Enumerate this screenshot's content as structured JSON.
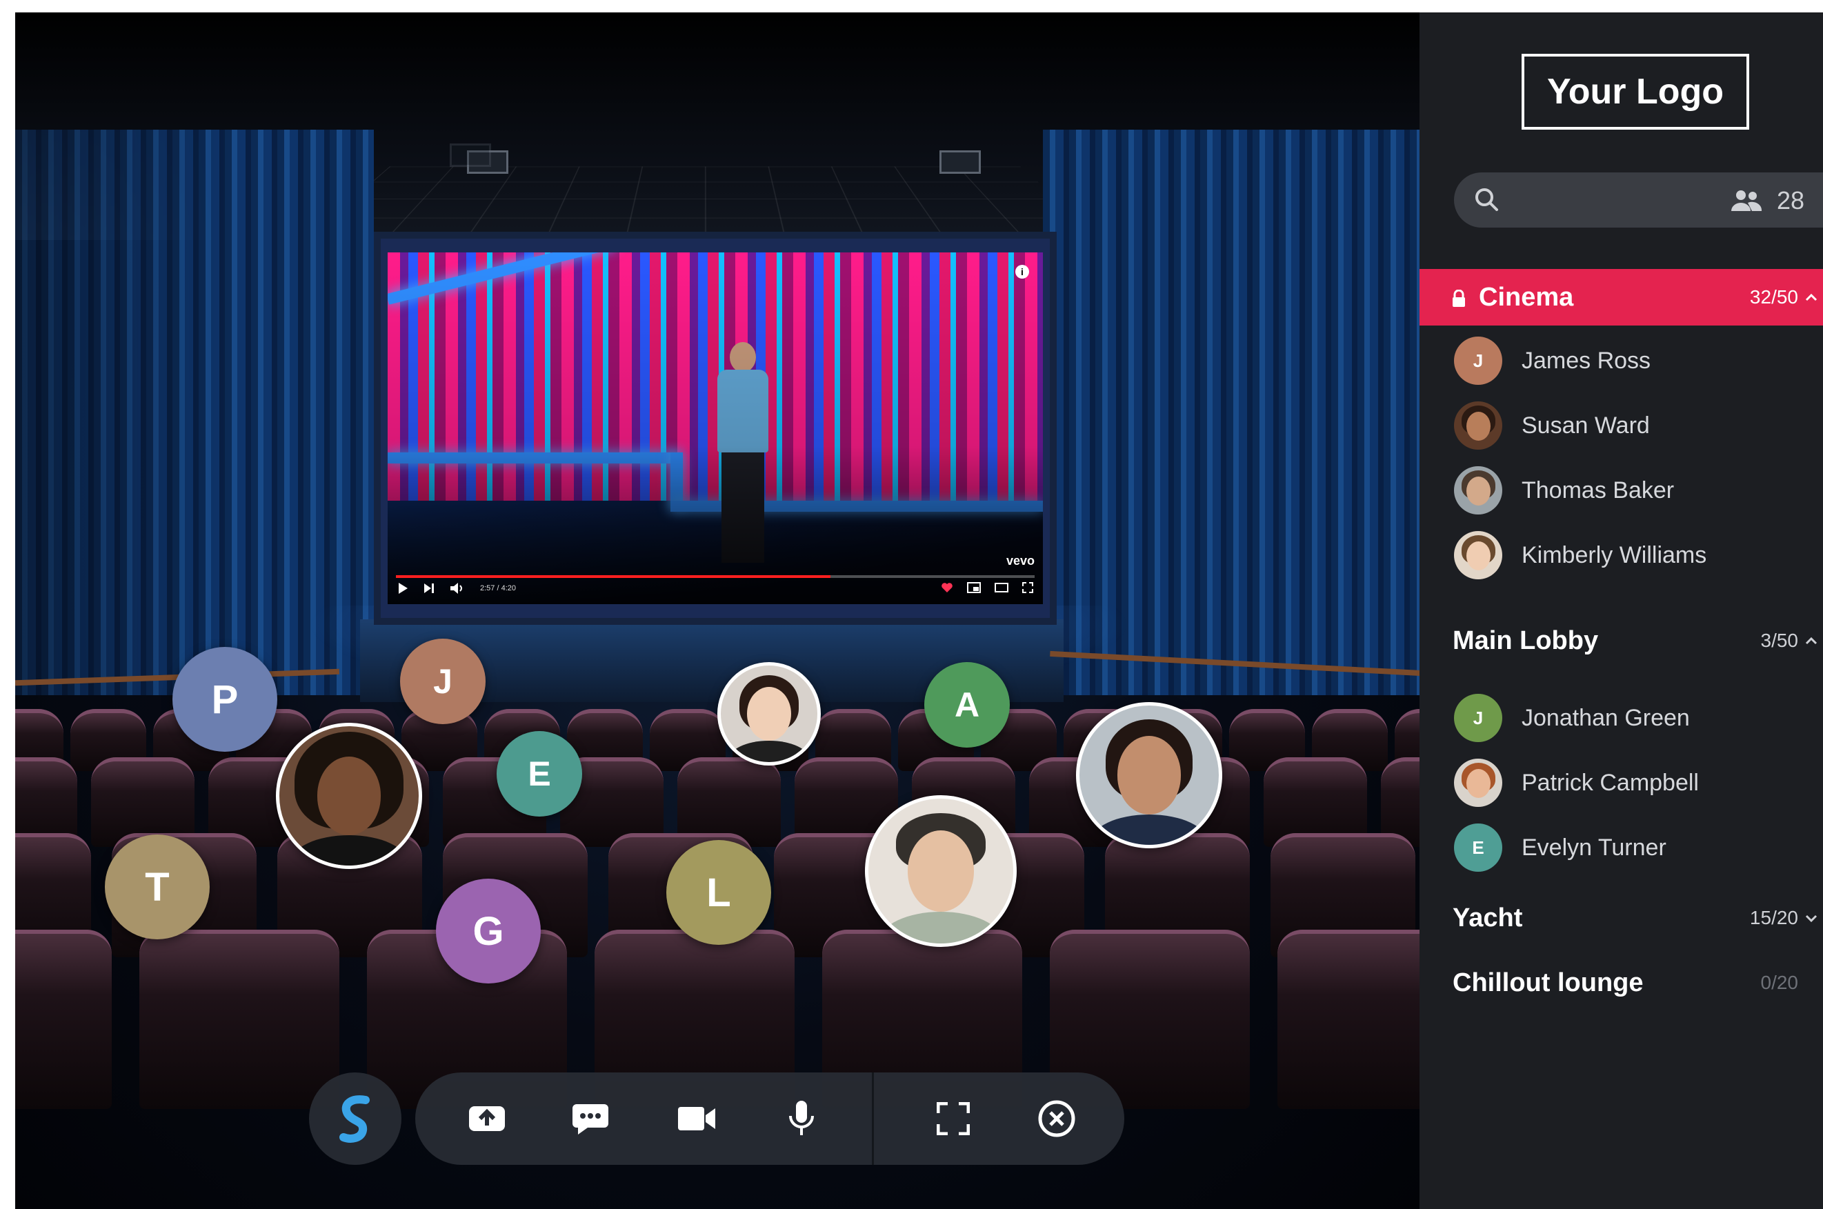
{
  "brand": {
    "logo_text": "Your Logo"
  },
  "search": {
    "placeholder": "",
    "online_count": "28",
    "search_icon": "search-icon",
    "people_icon": "people-icon"
  },
  "rooms": [
    {
      "name": "Cinema",
      "count": "32/50",
      "active": true,
      "locked": true,
      "expanded": true,
      "members": [
        {
          "name": "James Ross",
          "avatar_letter": "J",
          "avatar_color": "#b97a5e"
        },
        {
          "name": "Susan Ward",
          "avatar_type": "photo"
        },
        {
          "name": "Thomas Baker",
          "avatar_type": "photo"
        },
        {
          "name": "Kimberly Williams",
          "avatar_type": "photo"
        }
      ]
    },
    {
      "name": "Main Lobby",
      "count": "3/50",
      "expanded": true,
      "members": [
        {
          "name": "Jonathan Green",
          "avatar_letter": "J",
          "avatar_color": "#6f9a4a"
        },
        {
          "name": "Patrick Campbell",
          "avatar_type": "photo"
        },
        {
          "name": "Evelyn Turner",
          "avatar_letter": "E",
          "avatar_color": "#4f9e95"
        }
      ]
    },
    {
      "name": "Yacht",
      "count": "15/20",
      "expanded": false
    },
    {
      "name": "Chillout lounge",
      "count": "0/20"
    }
  ],
  "video": {
    "time": "2:57 / 4:20",
    "progress": 0.68,
    "watermark": "vevo",
    "info_glyph": "i",
    "accent": "#ff1f1f"
  },
  "stage_avatars": [
    {
      "letter": "P",
      "color": "#6c7fb0"
    },
    {
      "letter": "J",
      "color": "#b07a62"
    },
    {
      "letter": "E",
      "color": "#4d9b8f"
    },
    {
      "letter": "A",
      "color": "#4f9a5b"
    },
    {
      "letter": "T",
      "color": "#a8946a"
    },
    {
      "letter": "G",
      "color": "#9b64b0"
    },
    {
      "letter": "L",
      "color": "#a39a5e"
    }
  ],
  "toolbar": {
    "buttons": [
      "share-screen-icon",
      "chat-icon",
      "camera-icon",
      "microphone-icon",
      "fullscreen-icon",
      "leave-icon"
    ]
  },
  "colors": {
    "active_room": "#e4234f",
    "sidebar_bg": "#1c1e22",
    "toolbar_bg": "#282c34",
    "app_icon": "#3aa4e8"
  }
}
